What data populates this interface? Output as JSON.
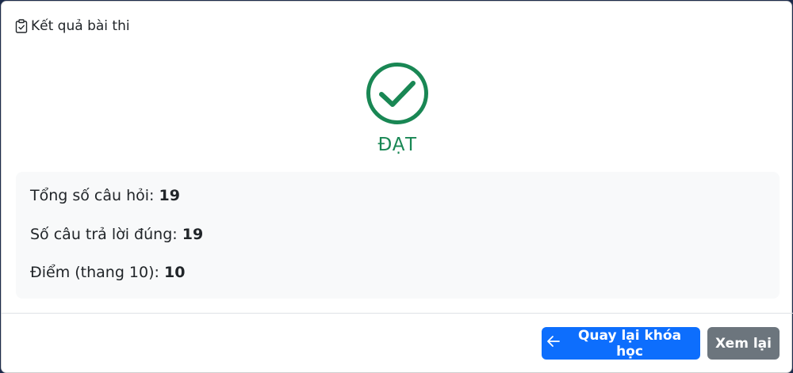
{
  "header": {
    "title": "Kết quả bài thi",
    "icon": "clipboard-check-icon"
  },
  "result": {
    "status": "ĐẠT",
    "icon": "check-circle-icon",
    "color": "#198754"
  },
  "summary": {
    "total_label": "Tổng số câu hỏi: ",
    "total_value": "19",
    "correct_label": "Số câu trả lời đúng: ",
    "correct_value": "19",
    "score_label": "Điểm (thang 10): ",
    "score_value": "10"
  },
  "footer": {
    "back_label": "Quay lại khóa học",
    "back_icon": "arrow-left-icon",
    "review_label": "Xem lại",
    "primary_color": "#0d6efd",
    "secondary_color": "#6c757d"
  }
}
